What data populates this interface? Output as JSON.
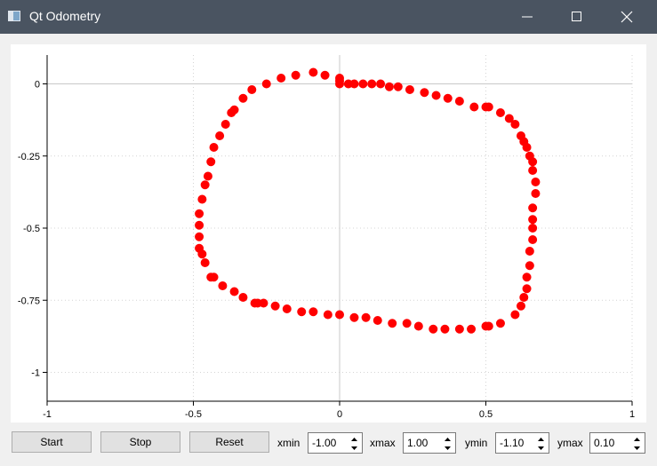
{
  "window": {
    "title": "Qt Odometry",
    "icon": "app-window-icon"
  },
  "buttons": {
    "start": "Start",
    "stop": "Stop",
    "reset": "Reset"
  },
  "spinboxes": {
    "xmin": {
      "label": "xmin",
      "value": "-1.00"
    },
    "xmax": {
      "label": "xmax",
      "value": "1.00"
    },
    "ymin": {
      "label": "ymin",
      "value": "-1.10"
    },
    "ymax": {
      "label": "ymax",
      "value": "0.10"
    }
  },
  "chart_data": {
    "type": "scatter",
    "xlim": [
      -1,
      1
    ],
    "ylim": [
      -1.1,
      0.1
    ],
    "xticks": [
      "-1",
      "-0.5",
      "0",
      "0.5",
      "1"
    ],
    "yticks": [
      "0",
      "-0.25",
      "-0.5",
      "-0.75",
      "-1"
    ],
    "grid": true,
    "marker_color": "#ff0000",
    "points": [
      [
        0.0,
        0.02
      ],
      [
        0.0,
        0.0
      ],
      [
        0.03,
        0.0
      ],
      [
        0.05,
        0.0
      ],
      [
        0.08,
        0.0
      ],
      [
        0.11,
        0.0
      ],
      [
        0.14,
        0.0
      ],
      [
        0.17,
        -0.01
      ],
      [
        0.2,
        -0.01
      ],
      [
        0.24,
        -0.02
      ],
      [
        0.29,
        -0.03
      ],
      [
        0.33,
        -0.04
      ],
      [
        0.37,
        -0.05
      ],
      [
        0.41,
        -0.06
      ],
      [
        0.46,
        -0.08
      ],
      [
        0.5,
        -0.08
      ],
      [
        0.51,
        -0.08
      ],
      [
        0.55,
        -0.1
      ],
      [
        0.58,
        -0.12
      ],
      [
        0.6,
        -0.14
      ],
      [
        0.62,
        -0.18
      ],
      [
        0.63,
        -0.2
      ],
      [
        0.64,
        -0.22
      ],
      [
        0.65,
        -0.25
      ],
      [
        0.66,
        -0.27
      ],
      [
        0.66,
        -0.3
      ],
      [
        0.67,
        -0.34
      ],
      [
        0.67,
        -0.38
      ],
      [
        0.66,
        -0.43
      ],
      [
        0.66,
        -0.47
      ],
      [
        0.66,
        -0.5
      ],
      [
        0.66,
        -0.54
      ],
      [
        0.65,
        -0.58
      ],
      [
        0.65,
        -0.63
      ],
      [
        0.64,
        -0.67
      ],
      [
        0.64,
        -0.71
      ],
      [
        0.63,
        -0.74
      ],
      [
        0.62,
        -0.77
      ],
      [
        0.6,
        -0.8
      ],
      [
        0.55,
        -0.83
      ],
      [
        0.51,
        -0.84
      ],
      [
        0.5,
        -0.84
      ],
      [
        0.45,
        -0.85
      ],
      [
        0.41,
        -0.85
      ],
      [
        0.36,
        -0.85
      ],
      [
        0.32,
        -0.85
      ],
      [
        0.27,
        -0.84
      ],
      [
        0.23,
        -0.83
      ],
      [
        0.18,
        -0.83
      ],
      [
        0.13,
        -0.82
      ],
      [
        0.09,
        -0.81
      ],
      [
        0.05,
        -0.81
      ],
      [
        0.0,
        -0.8
      ],
      [
        -0.04,
        -0.8
      ],
      [
        -0.09,
        -0.79
      ],
      [
        -0.13,
        -0.79
      ],
      [
        -0.18,
        -0.78
      ],
      [
        -0.22,
        -0.77
      ],
      [
        -0.26,
        -0.76
      ],
      [
        -0.28,
        -0.76
      ],
      [
        -0.29,
        -0.76
      ],
      [
        -0.33,
        -0.74
      ],
      [
        -0.36,
        -0.72
      ],
      [
        -0.4,
        -0.7
      ],
      [
        -0.43,
        -0.67
      ],
      [
        -0.44,
        -0.67
      ],
      [
        -0.46,
        -0.62
      ],
      [
        -0.47,
        -0.59
      ],
      [
        -0.48,
        -0.57
      ],
      [
        -0.48,
        -0.53
      ],
      [
        -0.48,
        -0.49
      ],
      [
        -0.48,
        -0.45
      ],
      [
        -0.47,
        -0.4
      ],
      [
        -0.46,
        -0.35
      ],
      [
        -0.45,
        -0.32
      ],
      [
        -0.44,
        -0.27
      ],
      [
        -0.43,
        -0.22
      ],
      [
        -0.41,
        -0.18
      ],
      [
        -0.39,
        -0.14
      ],
      [
        -0.37,
        -0.1
      ],
      [
        -0.36,
        -0.09
      ],
      [
        -0.33,
        -0.05
      ],
      [
        -0.3,
        -0.02
      ],
      [
        -0.25,
        0.0
      ],
      [
        -0.2,
        0.02
      ],
      [
        -0.15,
        0.03
      ],
      [
        -0.09,
        0.04
      ],
      [
        -0.05,
        0.03
      ],
      [
        0.0,
        0.01
      ]
    ]
  }
}
